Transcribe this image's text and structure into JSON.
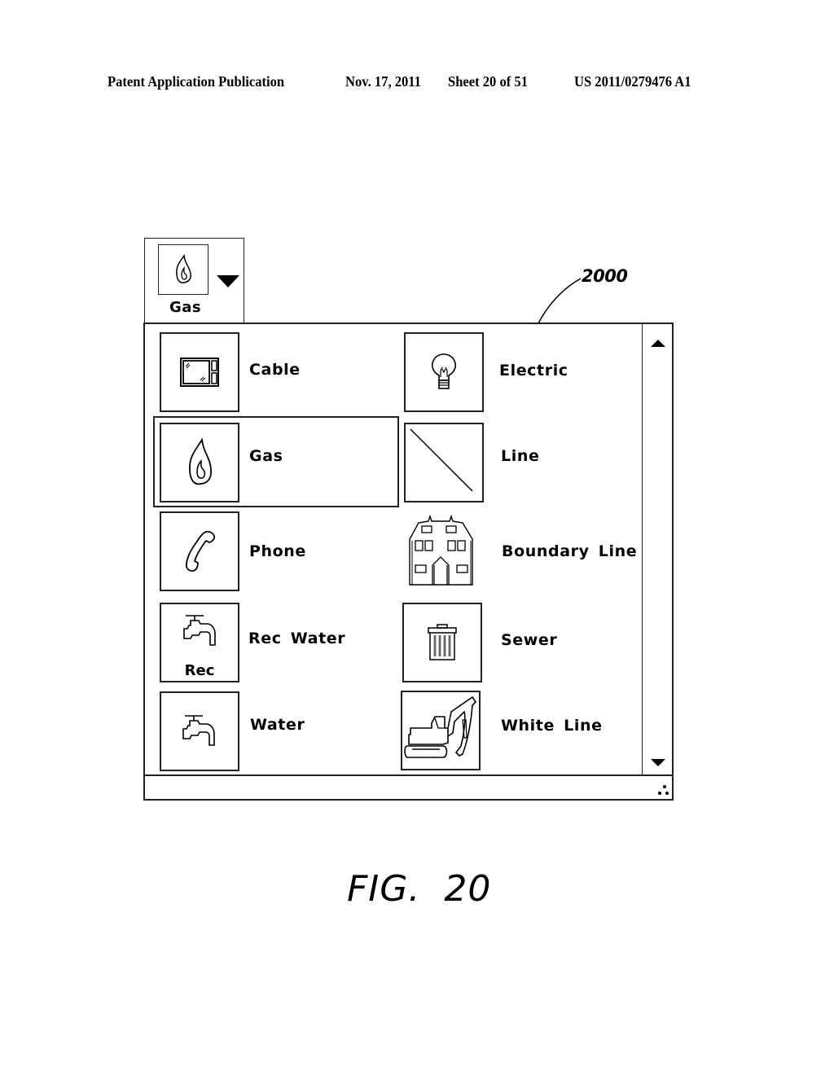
{
  "header": {
    "publication": "Patent Application Publication",
    "date": "Nov. 17, 2011",
    "sheet": "Sheet 20 of 51",
    "number": "US 2011/0279476 A1"
  },
  "selector": {
    "selected_label": "Gas",
    "selected_icon": "flame-icon"
  },
  "reference_numeral": "2000",
  "palette": {
    "items": [
      {
        "label": "Cable",
        "icon": "tv-icon"
      },
      {
        "label": "Electric",
        "icon": "lightbulb-icon"
      },
      {
        "label": "Gas",
        "icon": "flame-icon",
        "selected": true
      },
      {
        "label": "Line",
        "icon": "diagonal-line-icon"
      },
      {
        "label": "Phone",
        "icon": "phone-handset-icon"
      },
      {
        "label": "Boundary Line",
        "icon": "house-icon"
      },
      {
        "label": "Rec Water",
        "icon": "faucet-icon",
        "sublabel": "Rec"
      },
      {
        "label": "Sewer",
        "icon": "trash-bin-icon"
      },
      {
        "label": "Water",
        "icon": "faucet-icon"
      },
      {
        "label": "White Line",
        "icon": "excavator-icon"
      }
    ]
  },
  "figure_caption": "FIG.  20"
}
